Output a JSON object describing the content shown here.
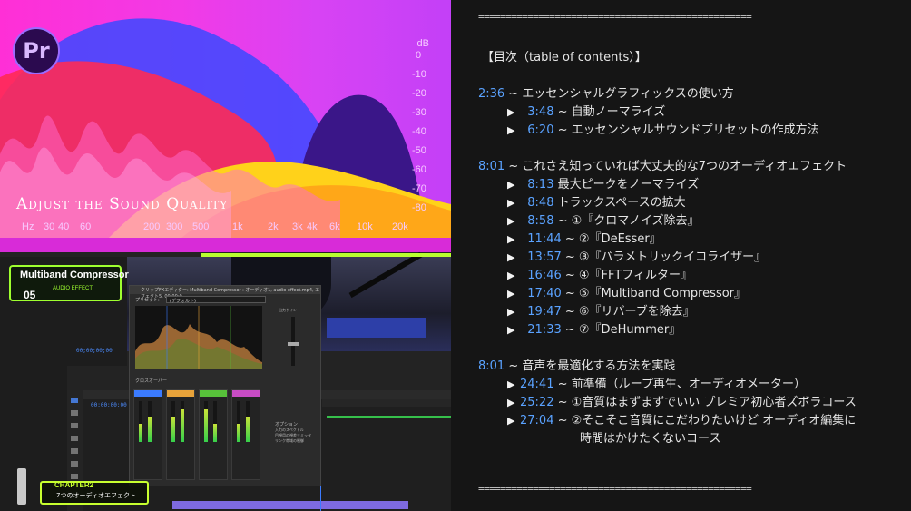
{
  "thumbnail": {
    "app_logo": "Pr",
    "headline": "Adjust the Sound Quality",
    "db_unit": "dB",
    "db_ticks": [
      "0",
      "-10",
      "-20",
      "-30",
      "-40",
      "-50",
      "-60",
      "-70",
      "-80"
    ],
    "hz_ticks": [
      "Hz",
      "30",
      "40",
      "60",
      "200",
      "300",
      "500",
      "1k",
      "2k",
      "3k",
      "4k",
      "6k",
      "10k",
      "20k"
    ],
    "effect_badge_title": "Multiband Compressor",
    "effect_badge_sub": "AUDIO EFFECT",
    "effect_badge_num": "05",
    "chapter_title": "CHAPTER2",
    "chapter_sub": "7つのオーディオエフェクト",
    "timecode_1": "00;00;00;00",
    "timecode_2": "00:00:00:00",
    "fx_panel_title": "クリップFXエディター: Multiband Compressor : オーディオ1, audio effect.mp4, エフェクト5, 00:00:0",
    "fx_preset_label": "プリセット:",
    "fx_preset_value": "(デフォルト)",
    "fx_crossover_label": "クロスオーバー",
    "fx_options_label": "オプション",
    "fx_options": [
      "入力のスペクトル",
      "目視用の視差リミッタ",
      "リンク帯域の制御"
    ],
    "fx_gain_label": "出力ゲイン",
    "bands": [
      {
        "color": "#3b7bff"
      },
      {
        "color": "#e8a33a"
      },
      {
        "color": "#57c13a"
      },
      {
        "color": "#c84cc4"
      }
    ]
  },
  "toc": {
    "rule": "==================================================",
    "heading": "【目次（table of contents）】",
    "items": [
      {
        "indent": 0,
        "time": "2:36",
        "sep": " ~ ",
        "text": "エッセンシャルグラフィックスの使い方",
        "tri": false
      },
      {
        "indent": 1,
        "time": "3:48",
        "sep": " ~ ",
        "text": "自動ノーマライズ",
        "tri": true
      },
      {
        "indent": 1,
        "time": "6:20",
        "sep": " ~ ",
        "text": "エッセンシャルサウンドプリセットの作成方法",
        "tri": true
      },
      {
        "indent": 0,
        "time": "8:01",
        "sep": " ~ ",
        "text": "これさえ知っていれば大丈夫的な7つのオーディオエフェクト",
        "tri": false
      },
      {
        "indent": 1,
        "time": "8:13",
        "sep": " ",
        "text": "最大ピークをノーマライズ",
        "tri": true
      },
      {
        "indent": 1,
        "time": "8:48",
        "sep": " ",
        "text": "トラックスペースの拡大",
        "tri": true
      },
      {
        "indent": 1,
        "time": "8:58",
        "sep": " ~ ",
        "text": "①『クロマノイズ除去』",
        "tri": true
      },
      {
        "indent": 1,
        "time": "11:44",
        "sep": " ~ ",
        "text": "②『DeEsser』",
        "tri": true
      },
      {
        "indent": 1,
        "time": "13:57",
        "sep": " ~ ",
        "text": "③『パラメトリックイコライザー』",
        "tri": true
      },
      {
        "indent": 1,
        "time": "16:46",
        "sep": " ~ ",
        "text": "④『FFTフィルター』",
        "tri": true
      },
      {
        "indent": 1,
        "time": "17:40",
        "sep": " ~ ",
        "text": "⑤『Multiband Compressor』",
        "tri": true
      },
      {
        "indent": 1,
        "time": "19:47",
        "sep": " ~ ",
        "text": "⑥『リバーブを除去』",
        "tri": true
      },
      {
        "indent": 1,
        "time": "21:33",
        "sep": " ~ ",
        "text": "⑦『DeHummer』",
        "tri": true
      },
      {
        "indent": 0,
        "time": "8:01",
        "sep": " ~ ",
        "text": "音声を最適化する方法を実践",
        "tri": false
      },
      {
        "indent": 2,
        "time": "24:41",
        "sep": " ~ ",
        "text": "前準備（ループ再生、オーディオメーター）",
        "tri": true
      },
      {
        "indent": 2,
        "time": "25:22",
        "sep": " ~ ",
        "text": "①音質はまずまずでいい プレミア初心者ズボラコース",
        "tri": true
      },
      {
        "indent": 2,
        "time": "27:04",
        "sep": " ~ ",
        "text": "②そこそこ音質にこだわりたいけど オーディオ編集に",
        "tri": true
      },
      {
        "indent": 3,
        "time": "",
        "sep": "",
        "text": "時間はかけたくないコース",
        "tri": false
      }
    ]
  }
}
